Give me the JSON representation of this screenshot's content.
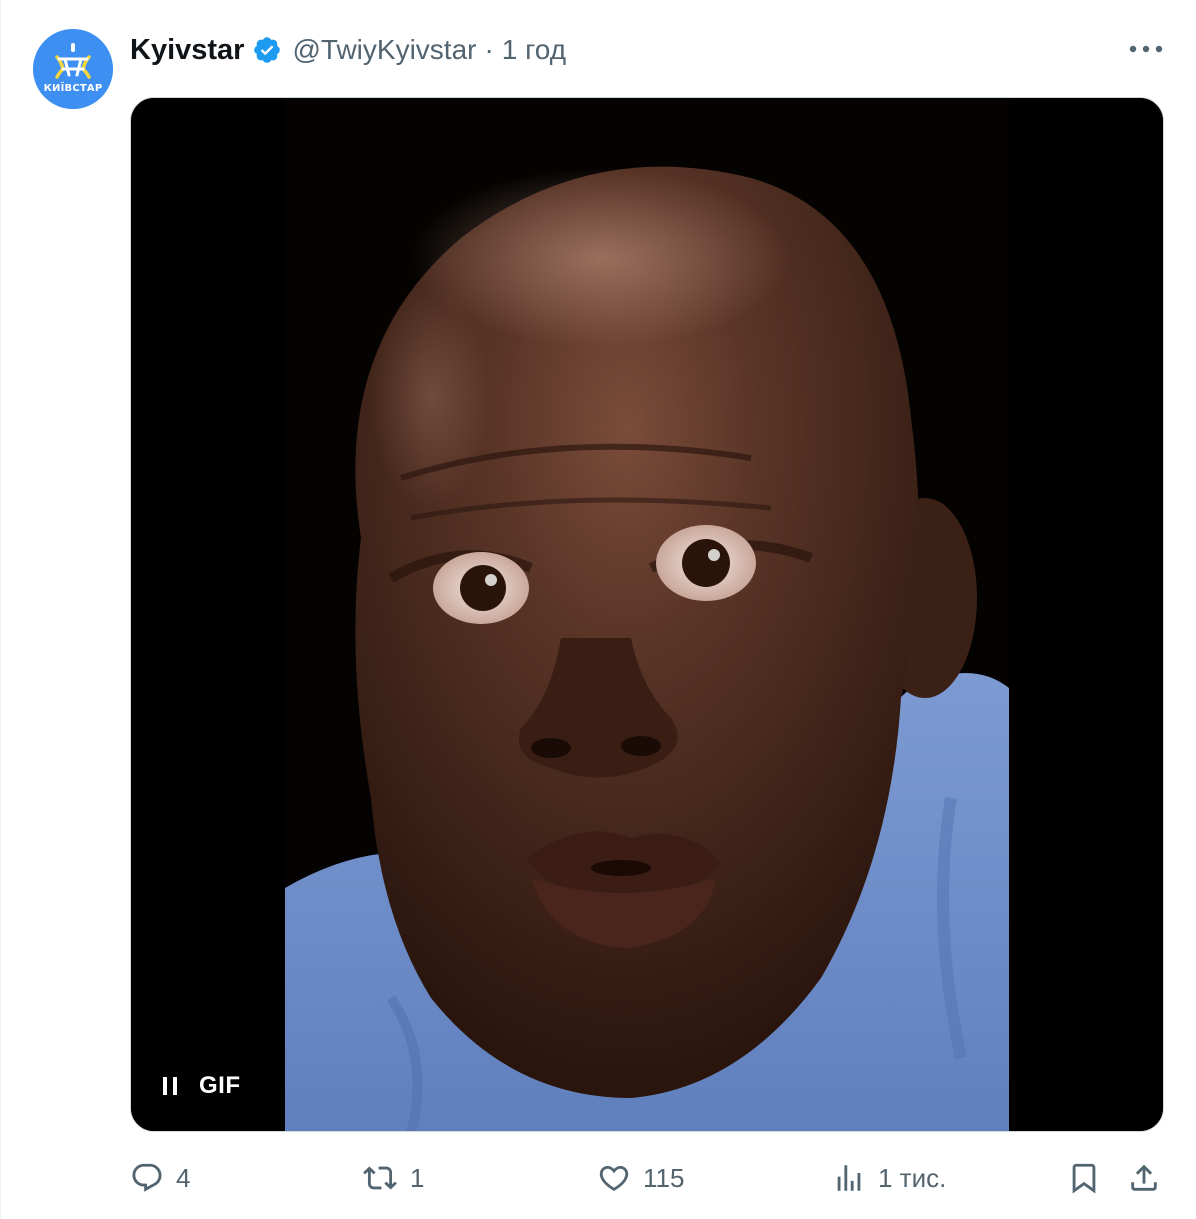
{
  "tweet": {
    "author": {
      "display_name": "Kyivstar",
      "handle": "@TwiyKyivstar",
      "avatar_label": "КИЇВСТАР",
      "verified": true
    },
    "separator": "·",
    "time": "1 год",
    "media": {
      "type": "GIF",
      "label": "GIF",
      "state": "playing"
    },
    "actions": {
      "reply_count": "4",
      "repost_count": "1",
      "like_count": "115",
      "views_count": "1 тис."
    }
  },
  "colors": {
    "brand_blue": "#3d8ff2",
    "verified_blue": "#1d9bf0",
    "text_primary": "#0f1419",
    "text_secondary": "#536471",
    "border": "#cfd9de",
    "media_background": "#000000",
    "shirt_blue": "#6f8fc9",
    "skin": "#4a2a1c"
  },
  "icons": [
    "verified-badge-icon",
    "more-icon",
    "pause-icon",
    "reply-icon",
    "repost-icon",
    "like-icon",
    "views-icon",
    "bookmark-icon",
    "share-icon"
  ]
}
